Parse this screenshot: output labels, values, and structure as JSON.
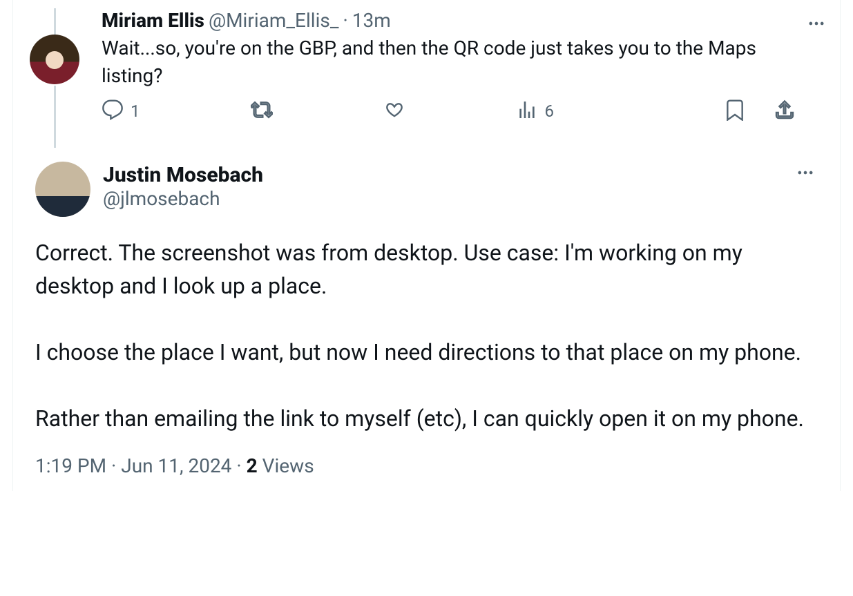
{
  "parent_tweet": {
    "display_name": "Miriam Ellis",
    "handle": "@Miriam_Ellis_",
    "separator": "·",
    "time": "13m",
    "text": "Wait...so, you're on the GBP, and then the QR code just takes you to the Maps listing?",
    "reply_count": "1",
    "views_count": "6"
  },
  "main_tweet": {
    "display_name": "Justin Mosebach",
    "handle": "@jlmosebach",
    "text": "Correct. The screenshot was from desktop. Use case: I'm working on my desktop and I look up a place.\n\nI choose the place I want, but now I need directions to that place on my phone.\n\nRather than emailing the link to myself (etc), I can quickly open it on my phone.",
    "timestamp": "1:19 PM · Jun 11, 2024",
    "meta_sep": " · ",
    "views_number": "2",
    "views_label": " Views"
  }
}
